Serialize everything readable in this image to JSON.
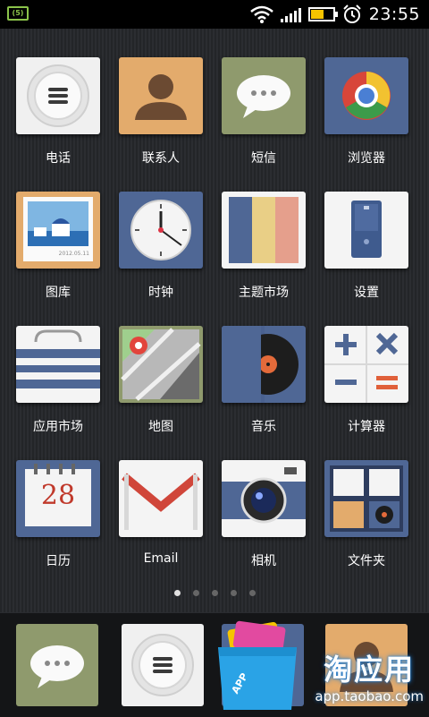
{
  "status_bar": {
    "left_badge": "(5)",
    "time": "23:55",
    "battery_level": 0.6
  },
  "apps": [
    {
      "label": "电话",
      "icon": "phone-icon"
    },
    {
      "label": "联系人",
      "icon": "contacts-icon"
    },
    {
      "label": "短信",
      "icon": "messages-icon"
    },
    {
      "label": "浏览器",
      "icon": "browser-icon"
    },
    {
      "label": "图库",
      "icon": "gallery-icon",
      "photo_caption": "2012.05.11"
    },
    {
      "label": "时钟",
      "icon": "clock-icon"
    },
    {
      "label": "主题市场",
      "icon": "themes-icon"
    },
    {
      "label": "设置",
      "icon": "settings-icon"
    },
    {
      "label": "应用市场",
      "icon": "app-market-icon"
    },
    {
      "label": "地图",
      "icon": "maps-icon"
    },
    {
      "label": "音乐",
      "icon": "music-icon"
    },
    {
      "label": "计算器",
      "icon": "calculator-icon"
    },
    {
      "label": "日历",
      "icon": "calendar-icon",
      "date": "28"
    },
    {
      "label": "Email",
      "icon": "email-icon"
    },
    {
      "label": "相机",
      "icon": "camera-icon"
    },
    {
      "label": "文件夹",
      "icon": "folder-icon"
    }
  ],
  "page_indicator": {
    "count": 5,
    "active": 1
  },
  "dock": [
    {
      "icon": "messages-icon"
    },
    {
      "icon": "phone-icon"
    },
    {
      "icon": "app-store-bag-icon",
      "badge": "APP"
    },
    {
      "icon": "contacts-icon"
    }
  ],
  "watermark": {
    "title": "淘应用",
    "url": "app.taobao.com"
  },
  "colors": {
    "tile_blue": "#4f6795",
    "tile_green": "#8f9a6d",
    "tile_orange": "#e0a86a",
    "tile_white": "#f2f2f2"
  }
}
